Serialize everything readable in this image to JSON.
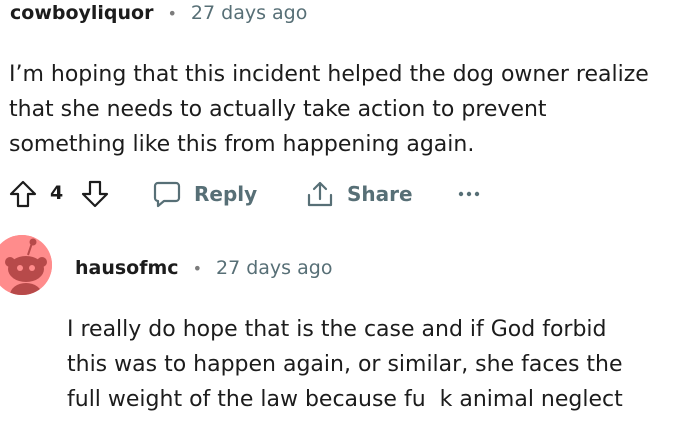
{
  "comments": [
    {
      "username": "cowboyliquor",
      "separator": "•",
      "time": "27 days ago",
      "body_lines": [
        "I’m hoping that this incident helped the dog owner realize",
        "that she needs to actually take action to prevent",
        "something like this from happening again."
      ],
      "actions": {
        "upvote_icon": "upvote-arrow-icon",
        "vote_count": "4",
        "downvote_icon": "downvote-arrow-icon",
        "reply_label": "Reply",
        "share_label": "Share",
        "more_icon": "ellipsis-icon"
      }
    },
    {
      "username": "hausofmc",
      "separator": "•",
      "time": "27 days ago",
      "avatar_color": "#ff8c8c",
      "body_lines": [
        "I really do hope that is the case and if God forbid",
        "this was to happen again, or similar, she faces the",
        "full weight of the law because fu  k animal neglect"
      ]
    }
  ],
  "colors": {
    "text": "#1c1c1c",
    "muted": "#576f76",
    "avatar_bg": "#ff8c8c"
  }
}
